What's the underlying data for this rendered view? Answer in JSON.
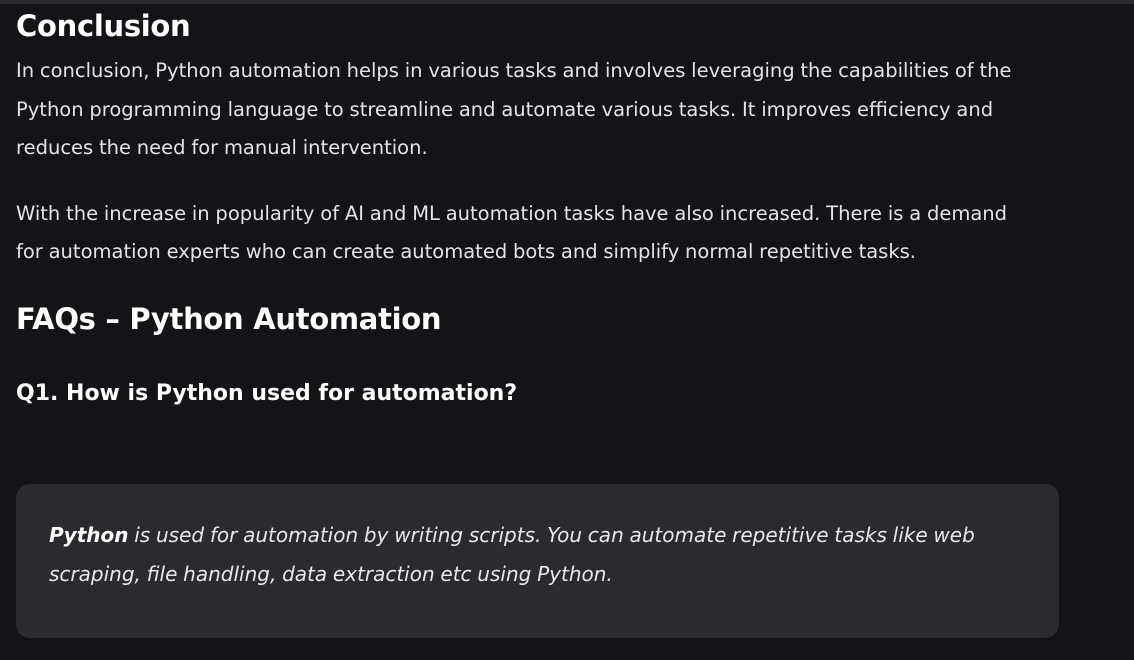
{
  "conclusion": {
    "heading": "Conclusion",
    "paragraphs": [
      "In conclusion, Python automation helps in various tasks and involves leveraging the capabilities of the Python programming language to streamline and automate various tasks. It improves efficiency and reduces the need for manual intervention.",
      "With the increase in popularity of AI and ML automation tasks have also increased. There is a demand for automation experts who can create automated bots and simplify normal repetitive tasks."
    ]
  },
  "faqs": {
    "heading": "FAQs – Python Automation",
    "items": [
      {
        "question": "Q1. How is Python used for automation?",
        "answer_bold": "Python",
        "answer_rest": " is used for automation by writing scripts. You can automate repetitive tasks like web scraping, file handling, data extraction etc using Python."
      }
    ]
  },
  "colors": {
    "background": "#131417",
    "answer_box": "#2a2b2e",
    "text": "#e8e8ea"
  }
}
